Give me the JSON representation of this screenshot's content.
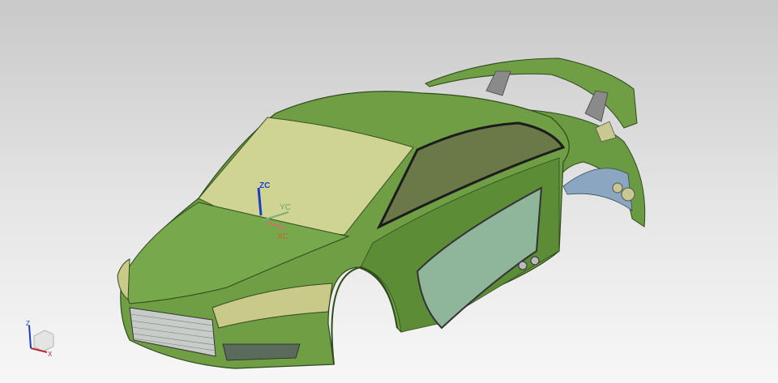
{
  "viewport": {
    "wcs_labels": {
      "z": "ZC",
      "y": "YC",
      "x": "XC"
    },
    "view_triad_labels": {
      "z": "Z",
      "x": "X"
    }
  },
  "colors": {
    "body": "#6f9e45",
    "body_dark": "#4d7a2e",
    "glass_yellow": "#d9d99a",
    "glass_dark": "#5b6b3a",
    "door_glass": "#8fb59a",
    "z_axis": "#1a3dc8",
    "y_axis": "#6aa86a",
    "x_axis": "#c86060"
  }
}
